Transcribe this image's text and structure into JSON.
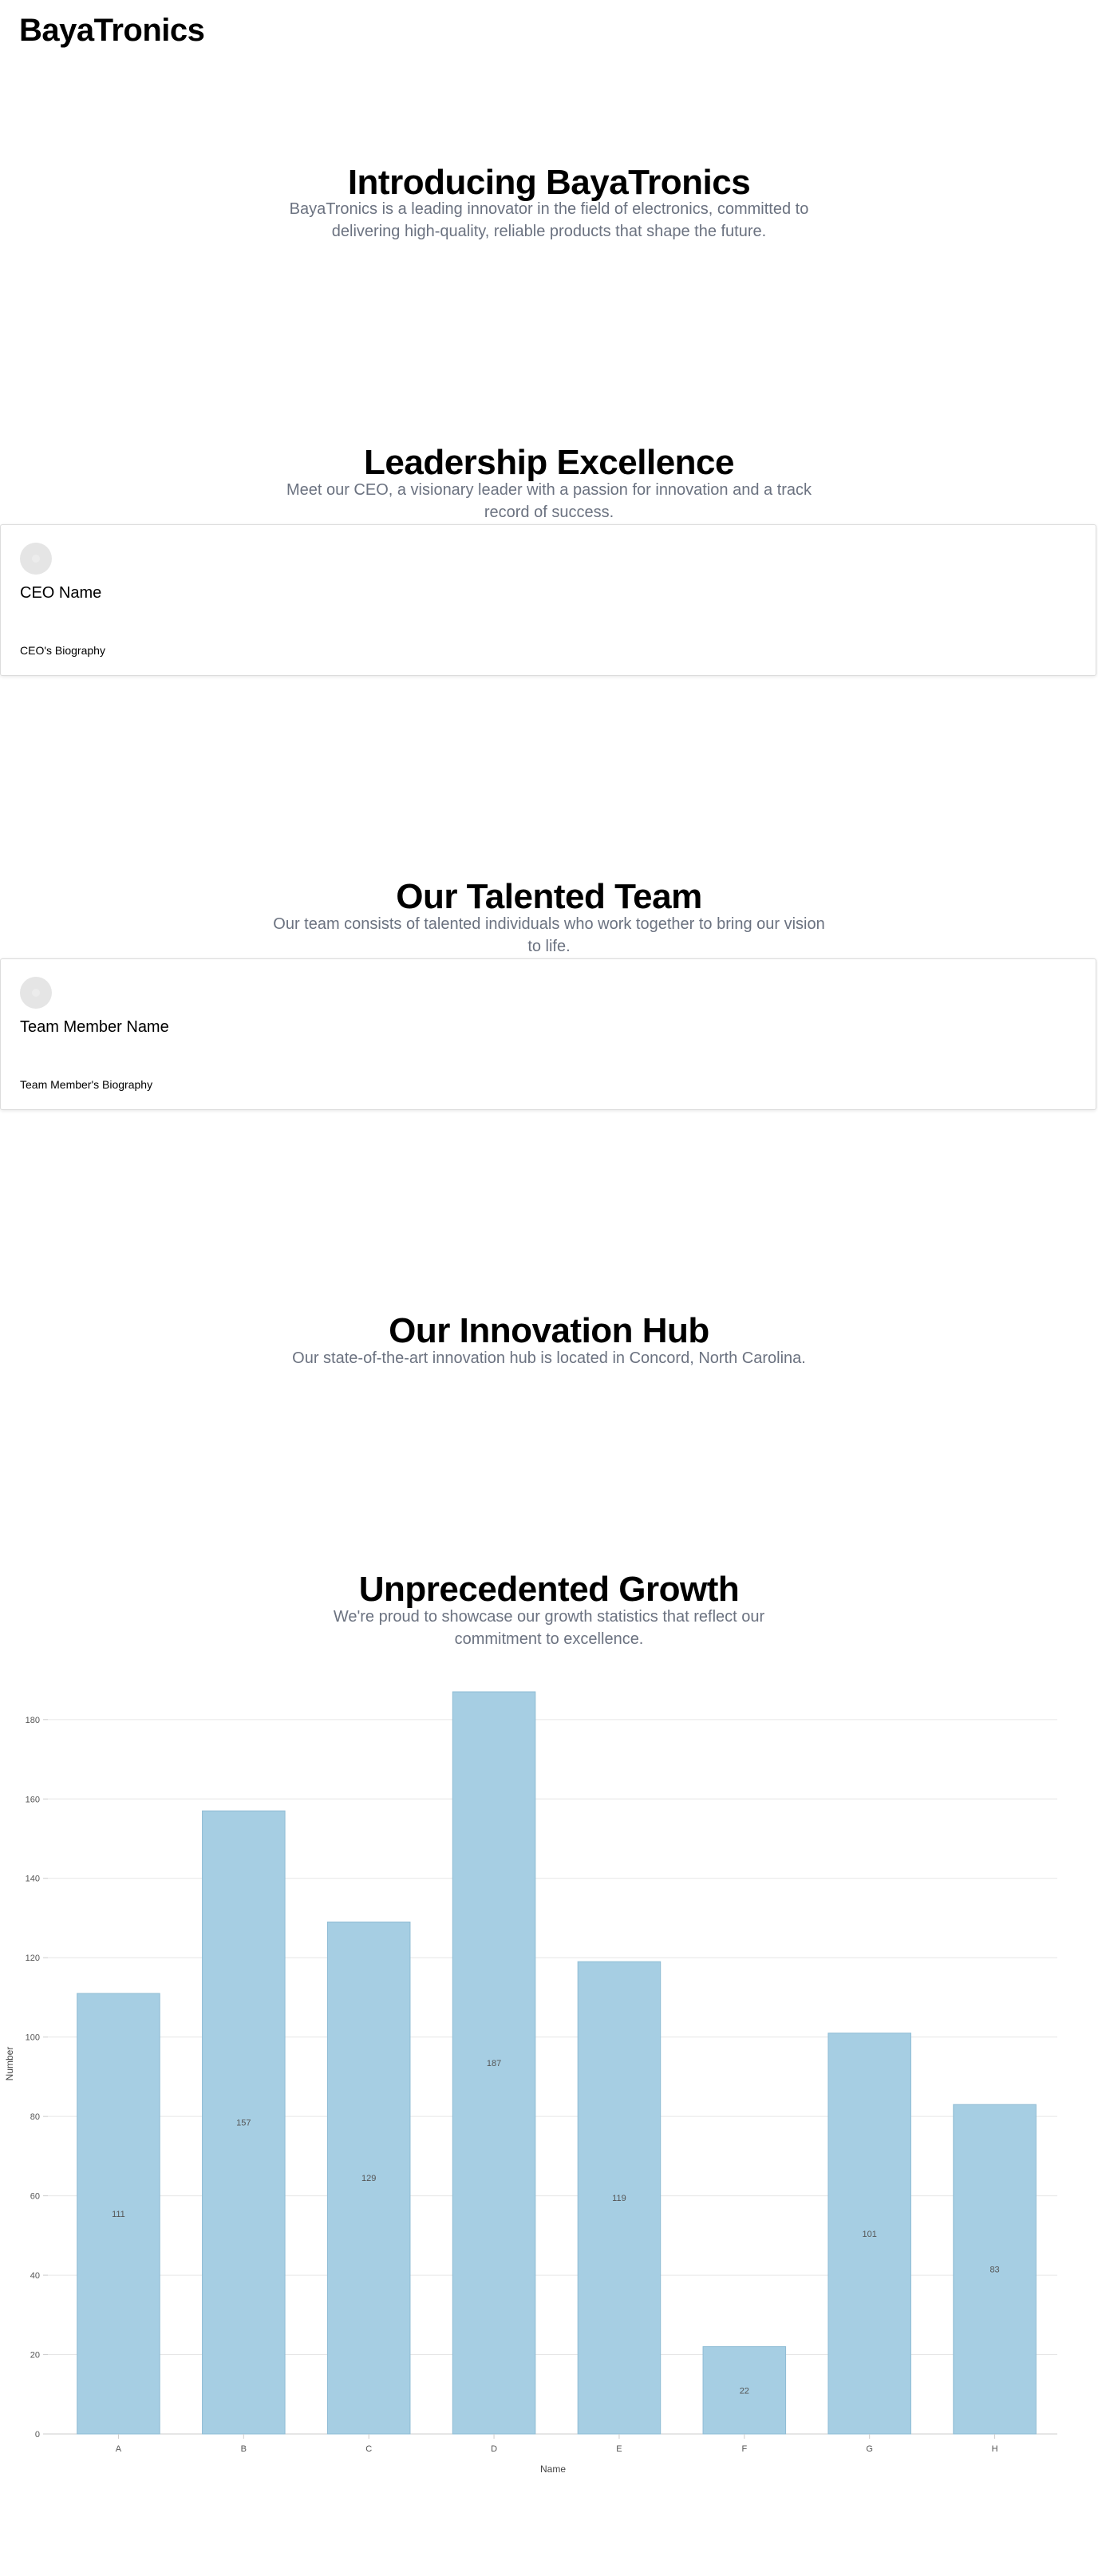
{
  "brand": "BayaTronics",
  "intro": {
    "title": "Introducing BayaTronics",
    "subtitle": "BayaTronics is a leading innovator in the field of electronics, committed to delivering high-quality, reliable products that shape the future."
  },
  "leadership": {
    "title": "Leadership Excellence",
    "subtitle": "Meet our CEO, a visionary leader with a passion for innovation and a track record of success.",
    "card": {
      "avatar_icon": "user-avatar-icon",
      "name": "CEO Name",
      "bio": "CEO's Biography"
    }
  },
  "team": {
    "title": "Our Talented Team",
    "subtitle": "Our team consists of talented individuals who work together to bring our vision to life.",
    "card": {
      "avatar_icon": "user-avatar-icon",
      "name": "Team Member Name",
      "bio": "Team Member's Biography"
    }
  },
  "hub": {
    "title": "Our Innovation Hub",
    "subtitle": "Our state-of-the-art innovation hub is located in Concord, North Carolina."
  },
  "growth": {
    "title": "Unprecedented Growth",
    "subtitle": "We're proud to showcase our growth statistics that reflect our commitment to excellence."
  },
  "colors": {
    "bar_fill": "#a6cee3",
    "bar_stroke": "#8fbcd4",
    "grid": "#e6e6e6",
    "axis": "#cccccc",
    "tick_text": "#555555",
    "subtitle_text": "#6b7280"
  },
  "chart_data": {
    "type": "bar",
    "categories": [
      "A",
      "B",
      "C",
      "D",
      "E",
      "F",
      "G",
      "H"
    ],
    "values": [
      111,
      157,
      129,
      187,
      119,
      22,
      101,
      83
    ],
    "data_labels": [
      "111",
      "157",
      "129",
      "187",
      "119",
      "22",
      "101",
      "83"
    ],
    "xlabel": "Name",
    "ylabel": "Number",
    "yticks": [
      0,
      20,
      40,
      60,
      80,
      100,
      120,
      140,
      160,
      180
    ],
    "ylim": [
      0,
      187
    ],
    "grid": true,
    "legend": "none"
  }
}
